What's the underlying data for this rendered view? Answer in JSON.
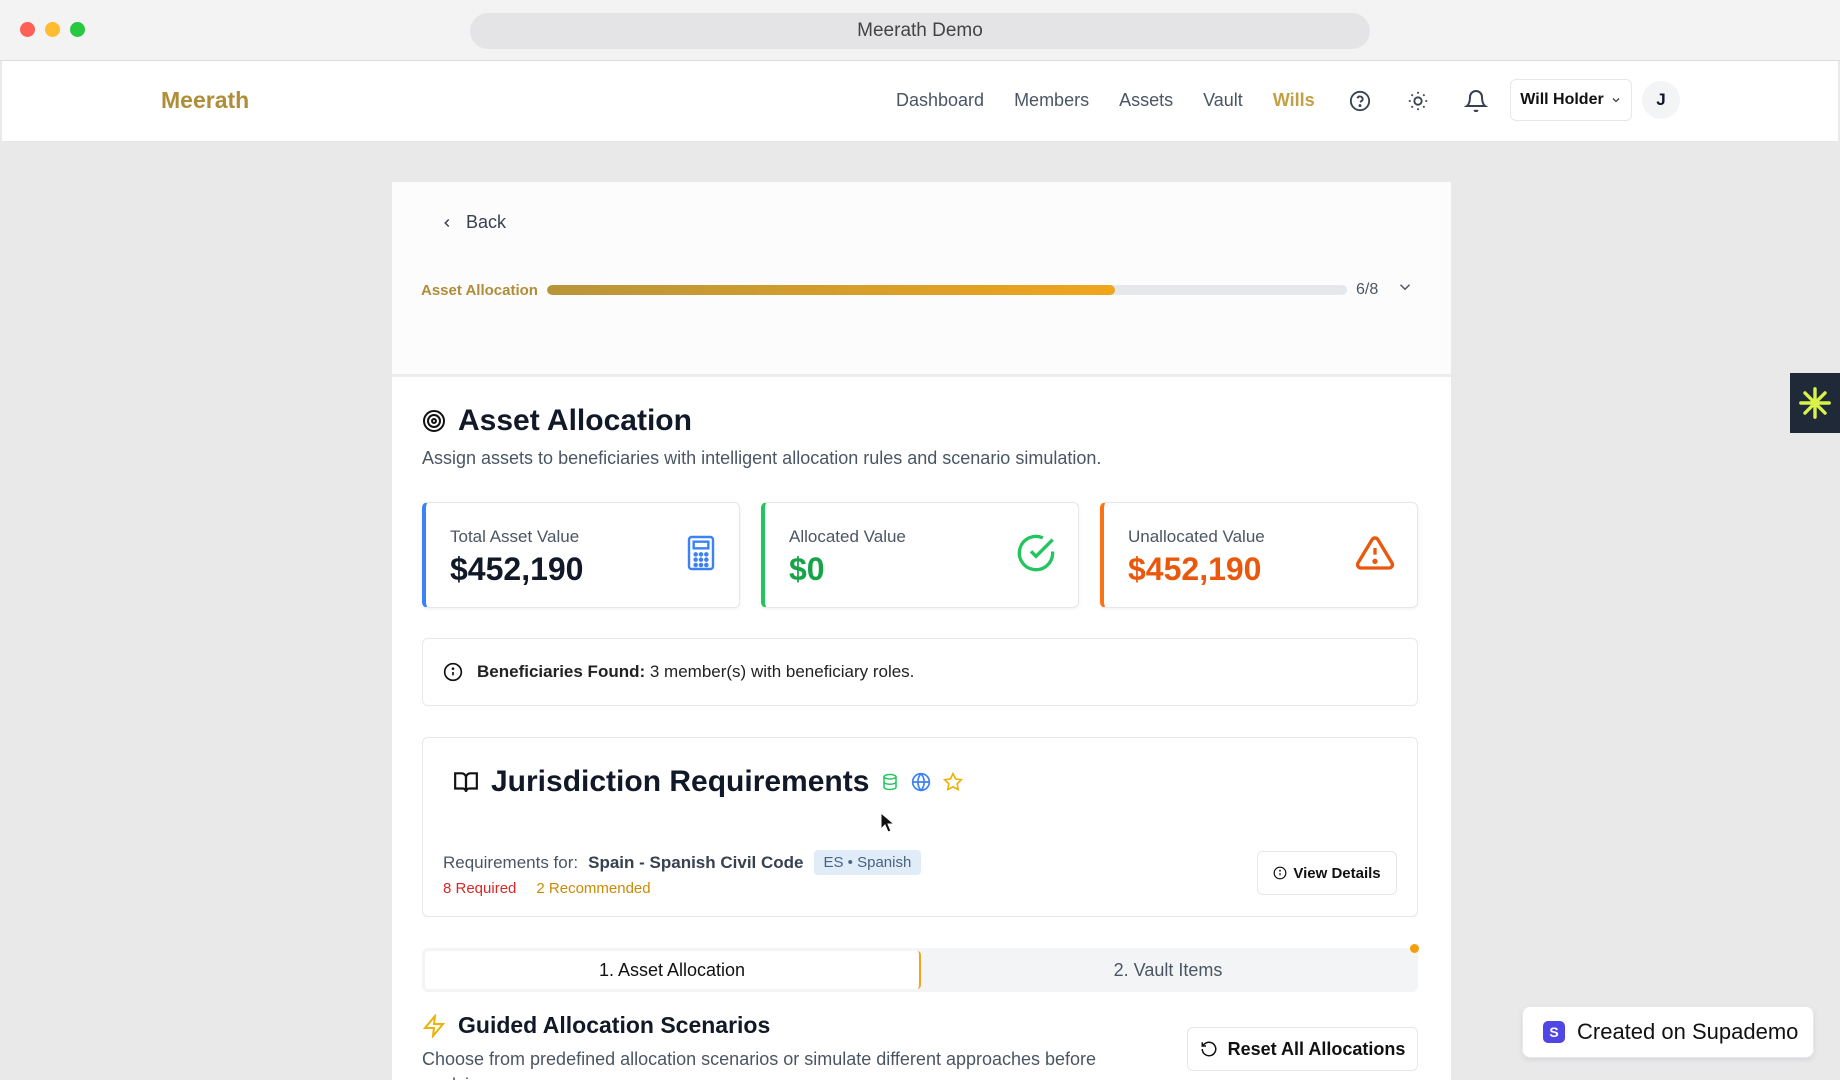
{
  "window": {
    "title": "Meerath Demo"
  },
  "header": {
    "logo": "Meerath",
    "nav": [
      "Dashboard",
      "Members",
      "Assets",
      "Vault",
      "Wills"
    ],
    "active_nav": "Wills",
    "user_name": "Will Holder",
    "avatar_initial": "J",
    "icons": [
      "help-circle-icon",
      "sun-icon",
      "bell-icon"
    ]
  },
  "progress": {
    "back_label": "Back",
    "label": "Asset Allocation",
    "count": "6/8",
    "fraction": 0.71
  },
  "section": {
    "title": "Asset Allocation",
    "description": "Assign assets to beneficiaries with intelligent allocation rules and scenario simulation."
  },
  "stats": [
    {
      "label": "Total Asset Value",
      "value": "$452,190",
      "color": "#111827",
      "accent": "#3b82f6",
      "icon": "calculator-icon"
    },
    {
      "label": "Allocated Value",
      "value": "$0",
      "color": "#16a34a",
      "accent": "#22c55e",
      "icon": "check-circle-icon"
    },
    {
      "label": "Unallocated Value",
      "value": "$452,190",
      "color": "#ea580c",
      "accent": "#f97316",
      "icon": "alert-triangle-icon"
    }
  ],
  "beneficiaries": {
    "label": "Beneficiaries Found:",
    "text": "3 member(s) with beneficiary roles."
  },
  "jurisdiction": {
    "title": "Jurisdiction Requirements",
    "requirements_prefix": "Requirements for:",
    "requirements_value": "Spain - Spanish Civil Code",
    "badge": "ES • Spanish",
    "required": "8 Required",
    "recommended": "2 Recommended",
    "view_button": "View Details"
  },
  "tabs": [
    "1. Asset Allocation",
    "2. Vault Items"
  ],
  "guided": {
    "title": "Guided Allocation Scenarios",
    "description": "Choose from predefined allocation scenarios or simulate different approaches before applying.",
    "reset_button": "Reset All Allocations"
  },
  "supademo": {
    "label": "Created on Supademo",
    "logo": "S"
  },
  "colors": {
    "brand": "#b08d38",
    "progress_start": "#b8953a",
    "progress_end": "#f0a51c"
  }
}
